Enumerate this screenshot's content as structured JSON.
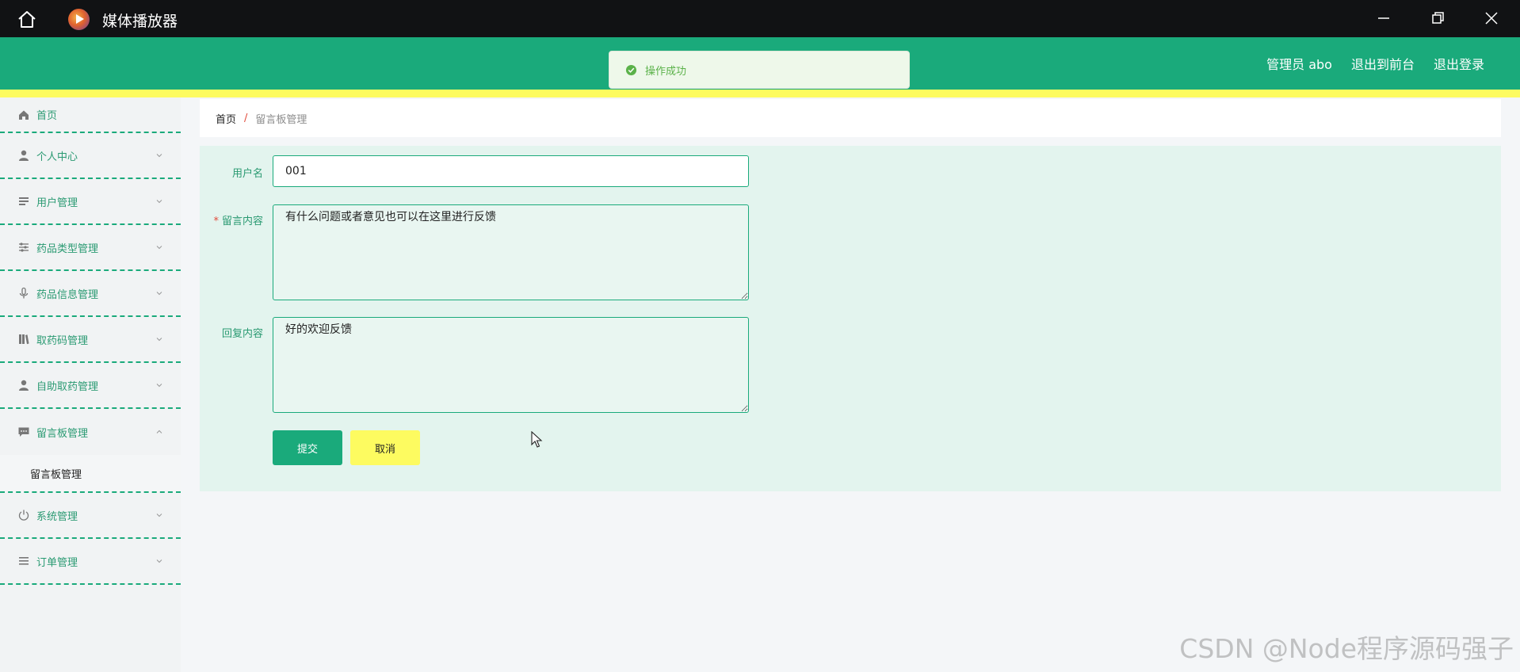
{
  "window": {
    "title": "媒体播放器"
  },
  "header": {
    "admin_label": "管理员 abo",
    "front_label": "退出到前台",
    "logout_label": "退出登录"
  },
  "toast": {
    "message": "操作成功"
  },
  "sidebar": {
    "items": [
      {
        "label": "首页",
        "icon": "home-icon"
      },
      {
        "label": "个人中心",
        "icon": "user-icon"
      },
      {
        "label": "用户管理",
        "icon": "list-icon"
      },
      {
        "label": "药品类型管理",
        "icon": "sliders-icon"
      },
      {
        "label": "药品信息管理",
        "icon": "microphone-icon"
      },
      {
        "label": "取药码管理",
        "icon": "library-icon"
      },
      {
        "label": "自助取药管理",
        "icon": "person-icon"
      },
      {
        "label": "留言板管理",
        "icon": "chat-icon"
      },
      {
        "label": "系统管理",
        "icon": "power-icon"
      },
      {
        "label": "订单管理",
        "icon": "list-icon"
      }
    ],
    "sub_item": "留言板管理"
  },
  "breadcrumb": {
    "home": "首页",
    "separator": "/",
    "current": "留言板管理"
  },
  "form": {
    "username_label": "用户名",
    "username_value": "001",
    "message_label": "留言内容",
    "message_required": "*",
    "message_value": "有什么问题或者意见也可以在这里进行反馈",
    "reply_label": "回复内容",
    "reply_value": "好的欢迎反馈",
    "submit_label": "提交",
    "cancel_label": "取消"
  },
  "watermark": "CSDN @Node程序源码强子",
  "colors": {
    "primary": "#1aaa7b",
    "accent_yellow": "#fdfb60",
    "panel_bg": "#e3f4ee"
  }
}
